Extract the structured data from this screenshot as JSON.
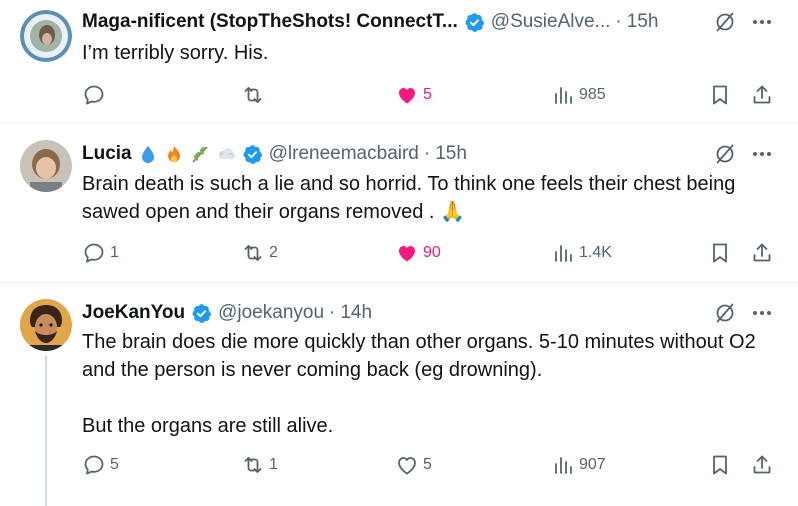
{
  "tweets": [
    {
      "name": "Maga-nificent (StopTheShots! ConnectT...",
      "handle": "@SusieAlve...",
      "time": "15h",
      "text": [
        "I’m terribly sorry. His."
      ],
      "reply_count": "",
      "repost_count": "",
      "like_count": "5",
      "liked": true,
      "views": "985"
    },
    {
      "name": "Lucia",
      "handle": "@lreneemacbaird",
      "time": "15h",
      "name_emojis": [
        "droplet-icon",
        "fire-icon",
        "herb-icon",
        "cloud-icon"
      ],
      "text": [
        "Brain death is such a lie and so horrid.  To think one feels their chest being sawed open and their organs removed . 🙏"
      ],
      "reply_count": "1",
      "repost_count": "2",
      "like_count": "90",
      "liked": true,
      "views": "1.4K"
    },
    {
      "name": "JoeKanYou",
      "handle": "@joekanyou",
      "time": "14h",
      "text": [
        "The brain does die more quickly than other organs. 5-10 minutes without O2 and the person is never coming back (eg drowning).",
        "But the organs are still alive."
      ],
      "reply_count": "5",
      "repost_count": "1",
      "like_count": "5",
      "liked": false,
      "views": "907"
    }
  ],
  "separator": "·",
  "colors": {
    "text": "#0f1419",
    "secondary": "#536471",
    "verified": "#1d9bf0",
    "like": "#f91880",
    "divider": "#eff3f4"
  }
}
